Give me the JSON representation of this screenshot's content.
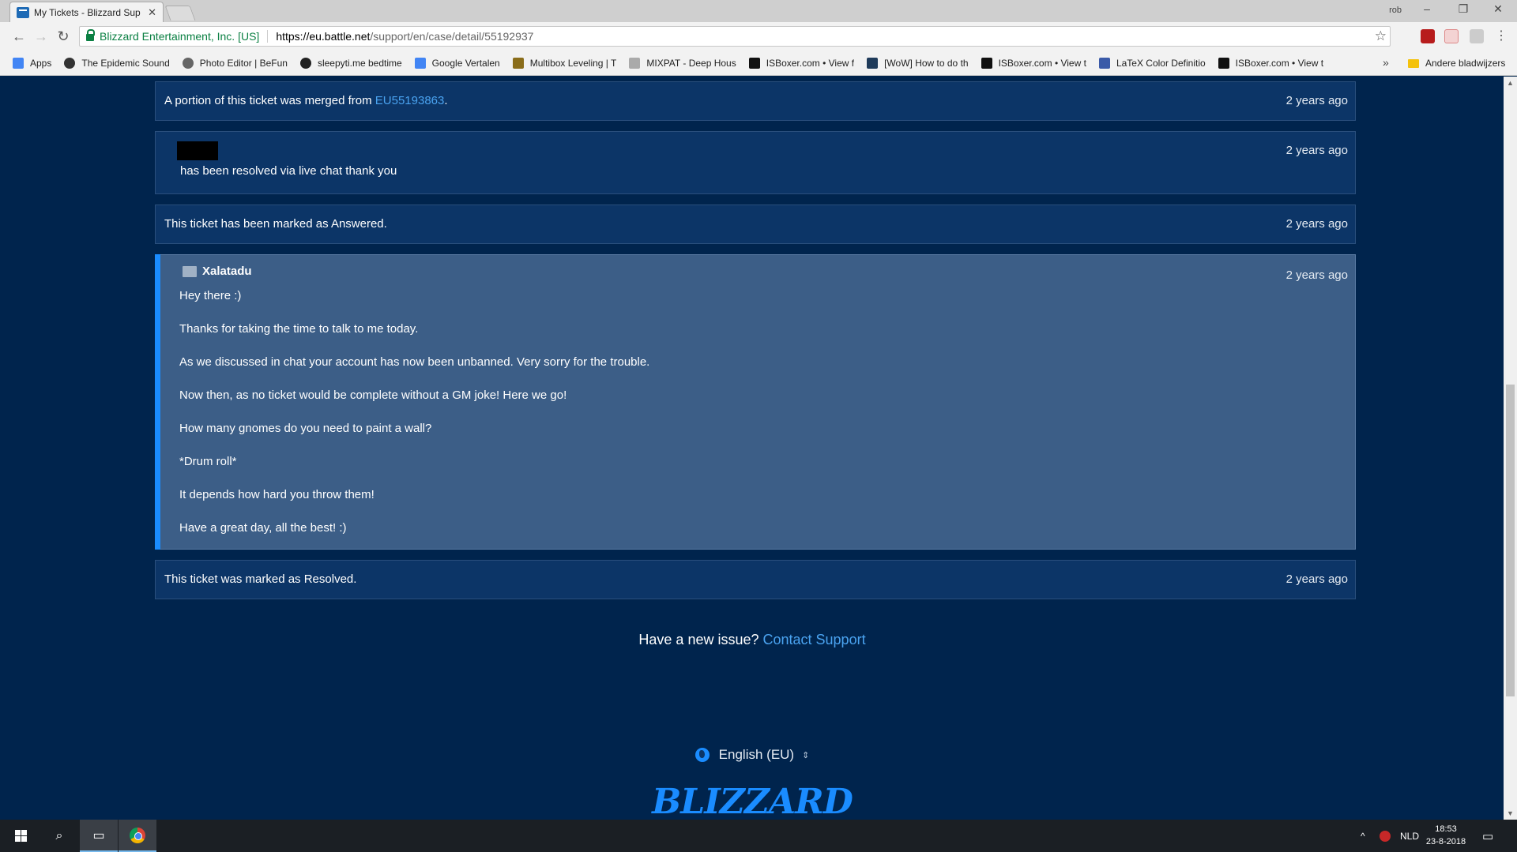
{
  "browser": {
    "tab_title": "My Tickets - Blizzard Sup",
    "tab_close": "✕",
    "profile": "rob",
    "org": "Blizzard Entertainment, Inc. [US]",
    "url_host": "https://eu.battle.net",
    "url_path": "/support/en/case/detail/55192937",
    "bookmarks": [
      {
        "label": "Apps",
        "color": "#4285f4"
      },
      {
        "label": "The Epidemic Sound",
        "color": "#333333"
      },
      {
        "label": "Photo Editor | BeFun",
        "color": "#666666"
      },
      {
        "label": "sleepyti.me bedtime",
        "color": "#222222"
      },
      {
        "label": "Google Vertalen",
        "color": "#4285f4"
      },
      {
        "label": "Multibox Leveling | T",
        "color": "#8a6d1a"
      },
      {
        "label": "MIXPAT - Deep Hous",
        "color": "#aaaaaa"
      },
      {
        "label": "ISBoxer.com • View f",
        "color": "#111111"
      },
      {
        "label": "[WoW] How to do th",
        "color": "#1f3b5a"
      },
      {
        "label": "ISBoxer.com • View t",
        "color": "#111111"
      },
      {
        "label": "LaTeX Color Definitio",
        "color": "#3a5aa8"
      },
      {
        "label": "ISBoxer.com • View t",
        "color": "#111111"
      }
    ],
    "bookmarks_more": "»",
    "other_bookmarks": "Andere bladwijzers"
  },
  "entries": {
    "merged_prefix": "A portion of this ticket was merged from ",
    "merged_link": "EU55193863",
    "merged_suffix": ".",
    "merged_time": "2 years ago",
    "resolved_chat_text": "has been resolved via live chat thank you",
    "resolved_chat_time": "2 years ago",
    "answered_text": "This ticket has been marked as Answered.",
    "answered_time": "2 years ago",
    "gm_author": "Xalatadu",
    "gm_time": "2 years ago",
    "gm_message": [
      "Hey there :)",
      "Thanks for taking the time to talk to me today.",
      "As we discussed in chat your account has now been unbanned. Very sorry for the trouble.",
      "Now then, as no ticket would be complete without a GM joke! Here we go!",
      "How many gnomes do you need to paint a wall?",
      "*Drum roll*",
      "It depends how hard you throw them!",
      "Have a great day, all the best! :)"
    ],
    "resolved_text": "This ticket was marked as Resolved.",
    "resolved_time": "2 years ago"
  },
  "footer": {
    "new_issue": "Have a new issue? ",
    "contact_link": "Contact Support",
    "language": "English (EU)",
    "logo": "BLIZZARD"
  },
  "taskbar": {
    "language": "NLD",
    "time": "18:53",
    "date": "23-8-2018"
  }
}
